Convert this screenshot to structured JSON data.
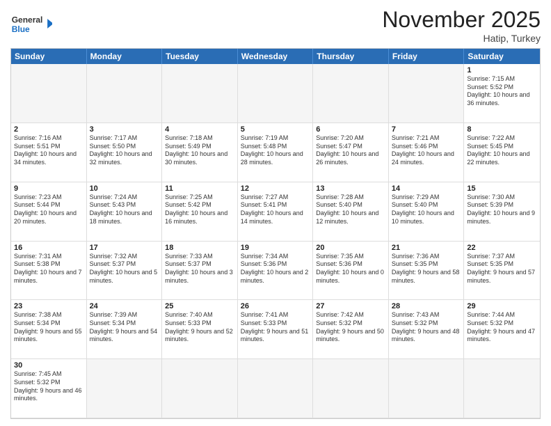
{
  "header": {
    "logo_general": "General",
    "logo_blue": "Blue",
    "month_title": "November 2025",
    "location": "Hatip, Turkey"
  },
  "days": [
    "Sunday",
    "Monday",
    "Tuesday",
    "Wednesday",
    "Thursday",
    "Friday",
    "Saturday"
  ],
  "cells": [
    {
      "day": "",
      "text": "",
      "empty": true
    },
    {
      "day": "",
      "text": "",
      "empty": true
    },
    {
      "day": "",
      "text": "",
      "empty": true
    },
    {
      "day": "",
      "text": "",
      "empty": true
    },
    {
      "day": "",
      "text": "",
      "empty": true
    },
    {
      "day": "",
      "text": "",
      "empty": true
    },
    {
      "day": "1",
      "text": "Sunrise: 7:15 AM\nSunset: 5:52 PM\nDaylight: 10 hours and 36 minutes.",
      "empty": false
    },
    {
      "day": "2",
      "text": "Sunrise: 7:16 AM\nSunset: 5:51 PM\nDaylight: 10 hours and 34 minutes.",
      "empty": false
    },
    {
      "day": "3",
      "text": "Sunrise: 7:17 AM\nSunset: 5:50 PM\nDaylight: 10 hours and 32 minutes.",
      "empty": false
    },
    {
      "day": "4",
      "text": "Sunrise: 7:18 AM\nSunset: 5:49 PM\nDaylight: 10 hours and 30 minutes.",
      "empty": false
    },
    {
      "day": "5",
      "text": "Sunrise: 7:19 AM\nSunset: 5:48 PM\nDaylight: 10 hours and 28 minutes.",
      "empty": false
    },
    {
      "day": "6",
      "text": "Sunrise: 7:20 AM\nSunset: 5:47 PM\nDaylight: 10 hours and 26 minutes.",
      "empty": false
    },
    {
      "day": "7",
      "text": "Sunrise: 7:21 AM\nSunset: 5:46 PM\nDaylight: 10 hours and 24 minutes.",
      "empty": false
    },
    {
      "day": "8",
      "text": "Sunrise: 7:22 AM\nSunset: 5:45 PM\nDaylight: 10 hours and 22 minutes.",
      "empty": false
    },
    {
      "day": "9",
      "text": "Sunrise: 7:23 AM\nSunset: 5:44 PM\nDaylight: 10 hours and 20 minutes.",
      "empty": false
    },
    {
      "day": "10",
      "text": "Sunrise: 7:24 AM\nSunset: 5:43 PM\nDaylight: 10 hours and 18 minutes.",
      "empty": false
    },
    {
      "day": "11",
      "text": "Sunrise: 7:25 AM\nSunset: 5:42 PM\nDaylight: 10 hours and 16 minutes.",
      "empty": false
    },
    {
      "day": "12",
      "text": "Sunrise: 7:27 AM\nSunset: 5:41 PM\nDaylight: 10 hours and 14 minutes.",
      "empty": false
    },
    {
      "day": "13",
      "text": "Sunrise: 7:28 AM\nSunset: 5:40 PM\nDaylight: 10 hours and 12 minutes.",
      "empty": false
    },
    {
      "day": "14",
      "text": "Sunrise: 7:29 AM\nSunset: 5:40 PM\nDaylight: 10 hours and 10 minutes.",
      "empty": false
    },
    {
      "day": "15",
      "text": "Sunrise: 7:30 AM\nSunset: 5:39 PM\nDaylight: 10 hours and 9 minutes.",
      "empty": false
    },
    {
      "day": "16",
      "text": "Sunrise: 7:31 AM\nSunset: 5:38 PM\nDaylight: 10 hours and 7 minutes.",
      "empty": false
    },
    {
      "day": "17",
      "text": "Sunrise: 7:32 AM\nSunset: 5:37 PM\nDaylight: 10 hours and 5 minutes.",
      "empty": false
    },
    {
      "day": "18",
      "text": "Sunrise: 7:33 AM\nSunset: 5:37 PM\nDaylight: 10 hours and 3 minutes.",
      "empty": false
    },
    {
      "day": "19",
      "text": "Sunrise: 7:34 AM\nSunset: 5:36 PM\nDaylight: 10 hours and 2 minutes.",
      "empty": false
    },
    {
      "day": "20",
      "text": "Sunrise: 7:35 AM\nSunset: 5:36 PM\nDaylight: 10 hours and 0 minutes.",
      "empty": false
    },
    {
      "day": "21",
      "text": "Sunrise: 7:36 AM\nSunset: 5:35 PM\nDaylight: 9 hours and 58 minutes.",
      "empty": false
    },
    {
      "day": "22",
      "text": "Sunrise: 7:37 AM\nSunset: 5:35 PM\nDaylight: 9 hours and 57 minutes.",
      "empty": false
    },
    {
      "day": "23",
      "text": "Sunrise: 7:38 AM\nSunset: 5:34 PM\nDaylight: 9 hours and 55 minutes.",
      "empty": false
    },
    {
      "day": "24",
      "text": "Sunrise: 7:39 AM\nSunset: 5:34 PM\nDaylight: 9 hours and 54 minutes.",
      "empty": false
    },
    {
      "day": "25",
      "text": "Sunrise: 7:40 AM\nSunset: 5:33 PM\nDaylight: 9 hours and 52 minutes.",
      "empty": false
    },
    {
      "day": "26",
      "text": "Sunrise: 7:41 AM\nSunset: 5:33 PM\nDaylight: 9 hours and 51 minutes.",
      "empty": false
    },
    {
      "day": "27",
      "text": "Sunrise: 7:42 AM\nSunset: 5:32 PM\nDaylight: 9 hours and 50 minutes.",
      "empty": false
    },
    {
      "day": "28",
      "text": "Sunrise: 7:43 AM\nSunset: 5:32 PM\nDaylight: 9 hours and 48 minutes.",
      "empty": false
    },
    {
      "day": "29",
      "text": "Sunrise: 7:44 AM\nSunset: 5:32 PM\nDaylight: 9 hours and 47 minutes.",
      "empty": false
    },
    {
      "day": "30",
      "text": "Sunrise: 7:45 AM\nSunset: 5:32 PM\nDaylight: 9 hours and 46 minutes.",
      "empty": false
    },
    {
      "day": "",
      "text": "",
      "empty": true
    },
    {
      "day": "",
      "text": "",
      "empty": true
    },
    {
      "day": "",
      "text": "",
      "empty": true
    },
    {
      "day": "",
      "text": "",
      "empty": true
    },
    {
      "day": "",
      "text": "",
      "empty": true
    },
    {
      "day": "",
      "text": "",
      "empty": true
    }
  ]
}
